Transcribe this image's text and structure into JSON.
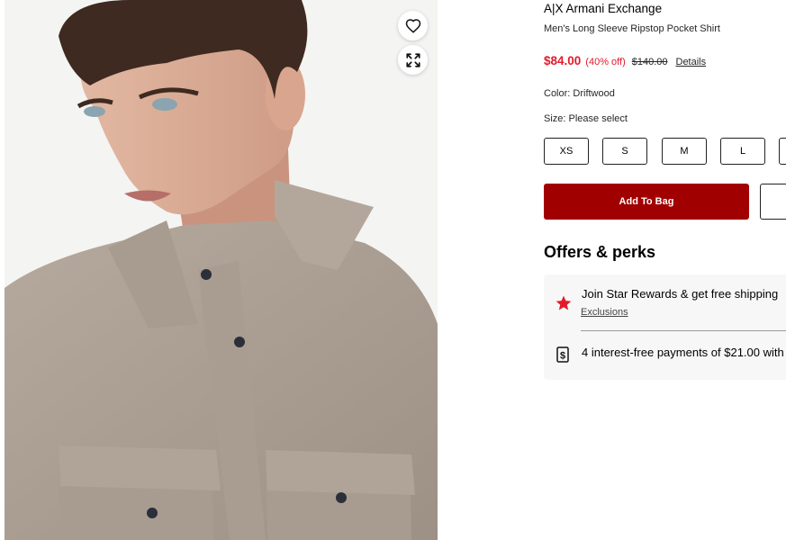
{
  "product": {
    "brand": "A|X Armani Exchange",
    "name": "Men's Long Sleeve Ripstop Pocket Shirt",
    "price": {
      "sale": "$84.00",
      "discount": "(40% off)",
      "original": "$140.00",
      "details_link": "Details"
    },
    "color_label": "Color: Driftwood",
    "size_label": "Size: Please select",
    "sizes": [
      "XS",
      "S",
      "M",
      "L"
    ],
    "add_to_bag_label": "Add To Bag"
  },
  "image_controls": {
    "favorite_icon": "heart-icon",
    "expand_icon": "expand-icon"
  },
  "offers": {
    "title": "Offers & perks",
    "items": [
      {
        "icon": "star-icon",
        "text": "Join Star Rewards & get free shipping",
        "link": "Exclusions"
      },
      {
        "icon": "dollar-icon",
        "text": "4 interest-free payments of $21.00 with"
      }
    ]
  },
  "colors": {
    "sale_price": "#e21a2c",
    "add_to_bag": "#a10000",
    "star": "#e21a2c",
    "offers_bg": "#f7f7f7"
  }
}
